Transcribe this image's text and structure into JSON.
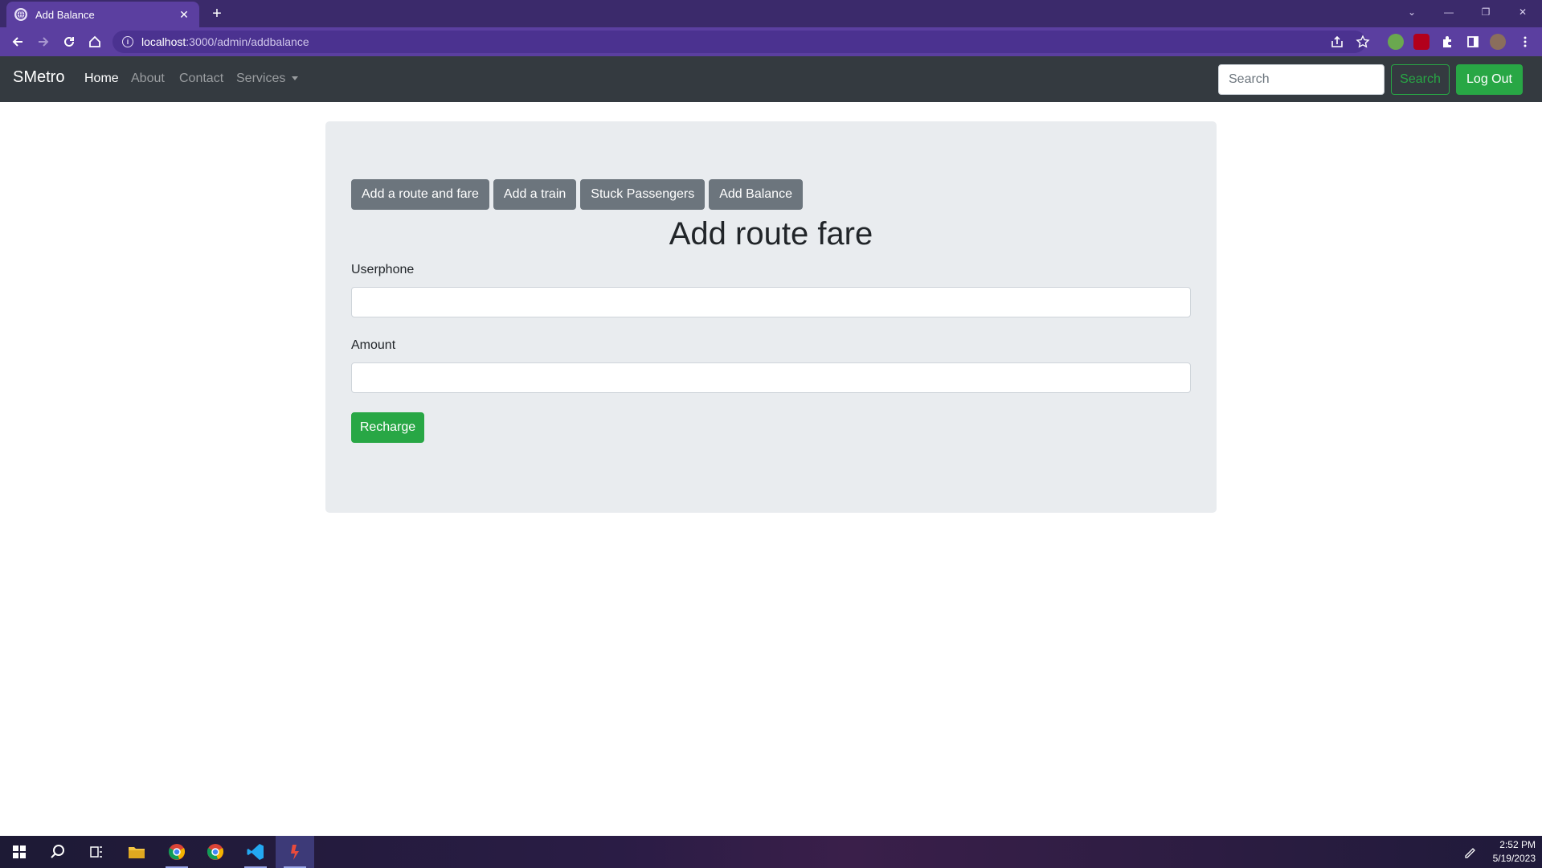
{
  "browser": {
    "tab_title": "Add Balance",
    "tab_close": "✕",
    "new_tab": "+",
    "url_host": "localhost",
    "url_path": ":3000/admin/addbalance"
  },
  "navbar": {
    "brand": "SMetro",
    "links": [
      "Home",
      "About",
      "Contact",
      "Services"
    ],
    "search_placeholder": "Search",
    "search_button": "Search",
    "logout_button": "Log Out"
  },
  "admin_menu": [
    "Add a route and fare",
    "Add a train",
    "Stuck Passengers",
    "Add Balance"
  ],
  "form": {
    "heading": "Add route fare",
    "userphone_label": "Userphone",
    "userphone_value": "",
    "amount_label": "Amount",
    "amount_value": "",
    "submit_label": "Recharge"
  },
  "taskbar": {
    "time": "2:52 PM",
    "date": "5/19/2023"
  },
  "colors": {
    "navbar": "#343a40",
    "success": "#28a745",
    "secondary": "#6c757d",
    "jumbotron": "#e9ecef",
    "browser_frame": "#5b3fa0"
  }
}
